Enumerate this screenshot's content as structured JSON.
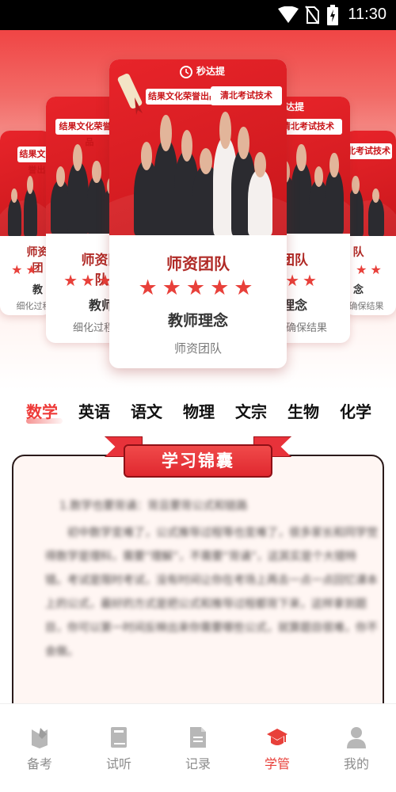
{
  "status_bar": {
    "time": "11:30"
  },
  "carousel": {
    "cards": [
      {
        "id": "far-left",
        "title": "师资团",
        "stars": "★★",
        "subtitle": "教",
        "footer": "细化过程",
        "banner1": "结果文化荣誉出品",
        "banner2": ""
      },
      {
        "id": "left",
        "title": "师资团队",
        "stars": "★★★",
        "subtitle": "教师",
        "footer": "细化过程",
        "banner1": "结果文化荣誉出品",
        "banner2": ""
      },
      {
        "id": "center",
        "title": "师资团队",
        "stars": "★★★★★",
        "subtitle": "教师理念",
        "footer": "师资团队",
        "logo": "秒达提",
        "banner1": "结果文化荣誉出品",
        "banner2": "清北考试技术"
      },
      {
        "id": "right",
        "title": "团队",
        "stars": "★★",
        "subtitle": "理念",
        "footer": "确保结果",
        "logo": "达提",
        "banner1": "",
        "banner2": "清北考试技术"
      },
      {
        "id": "far-right",
        "title": "队",
        "stars": "★★",
        "subtitle": "念",
        "footer": "确保结果",
        "banner1": "",
        "banner2": "清北考试技术"
      }
    ]
  },
  "subject_tabs": [
    {
      "label": "数学",
      "active": true
    },
    {
      "label": "英语",
      "active": false
    },
    {
      "label": "语文",
      "active": false
    },
    {
      "label": "物理",
      "active": false
    },
    {
      "label": "文宗",
      "active": false
    },
    {
      "label": "生物",
      "active": false
    },
    {
      "label": "化学",
      "active": false
    }
  ],
  "tips": {
    "title": "学习锦囊",
    "heading": "1.数学也要背诵：背且要背公式和链路",
    "paragraph": "初中数学变难了，公式推导过程等也变难了，很多家长和同学觉得数学是理科，需要“理解”，不需要“背诵”，这其实是个大错特错。考试是限时考试，没有时间让你在考场上再去一点一点回忆课本上的公式，最好的方式是把公式和推导过程都背下来，这样拿到题目，你可以第一时间反映出来你需要哪些公式，就算题目很难，你不会做。"
  },
  "bottom_nav": [
    {
      "label": "备考",
      "icon": "pencil-book-icon",
      "active": false
    },
    {
      "label": "试听",
      "icon": "book-icon",
      "active": false
    },
    {
      "label": "记录",
      "icon": "document-icon",
      "active": false
    },
    {
      "label": "学管",
      "icon": "graduation-cap-icon",
      "active": true
    },
    {
      "label": "我的",
      "icon": "user-icon",
      "active": false
    }
  ],
  "colors": {
    "accent": "#e8403a",
    "inactive": "#8c8c8c",
    "poster_red": "#d71d22"
  }
}
